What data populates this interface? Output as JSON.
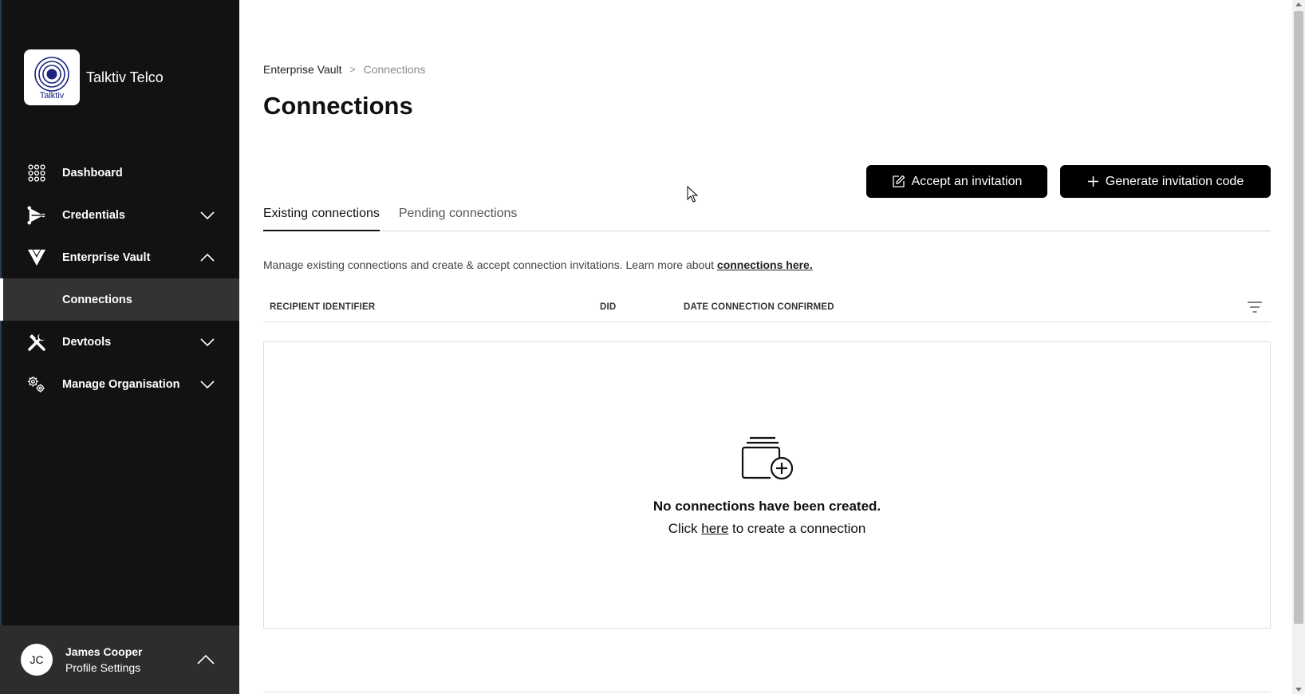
{
  "sidebar": {
    "org_name": "Talktiv Telco",
    "logo_text": "Talktiv",
    "nav": {
      "dashboard": "Dashboard",
      "credentials": "Credentials",
      "enterprise_vault": "Enterprise Vault",
      "connections": "Connections",
      "devtools": "Devtools",
      "manage_organisation": "Manage Organisation"
    },
    "profile": {
      "initials": "JC",
      "name": "James Cooper",
      "subtitle": "Profile Settings"
    }
  },
  "breadcrumb": {
    "parent": "Enterprise Vault",
    "separator": ">",
    "current": "Connections"
  },
  "page_title": "Connections",
  "buttons": {
    "accept": "Accept an invitation",
    "generate": "Generate invitation code"
  },
  "tabs": [
    {
      "label": "Existing connections",
      "active": true
    },
    {
      "label": "Pending connections",
      "active": false
    }
  ],
  "description": {
    "text": "Manage existing connections and create & accept connection invitations. Learn more about ",
    "link": "connections here."
  },
  "table": {
    "columns": [
      "RECIPIENT IDENTIFIER",
      "DID",
      "DATE CONNECTION CONFIRMED"
    ]
  },
  "empty_state": {
    "title": "No connections have been created.",
    "prefix": "Click ",
    "link": "here",
    "suffix": " to create a connection"
  },
  "icons": {
    "dashboard": "grid-icon",
    "credentials": "credential-icon",
    "vault": "vault-icon",
    "devtools": "tools-icon",
    "manage": "gears-icon",
    "filter": "filter-icon",
    "empty": "folder-add-icon"
  },
  "colors": {
    "sidebar_bg": "#121212",
    "active_item_bg": "#333333",
    "button_bg": "#000000",
    "profile_bg": "#2d2d2d"
  }
}
